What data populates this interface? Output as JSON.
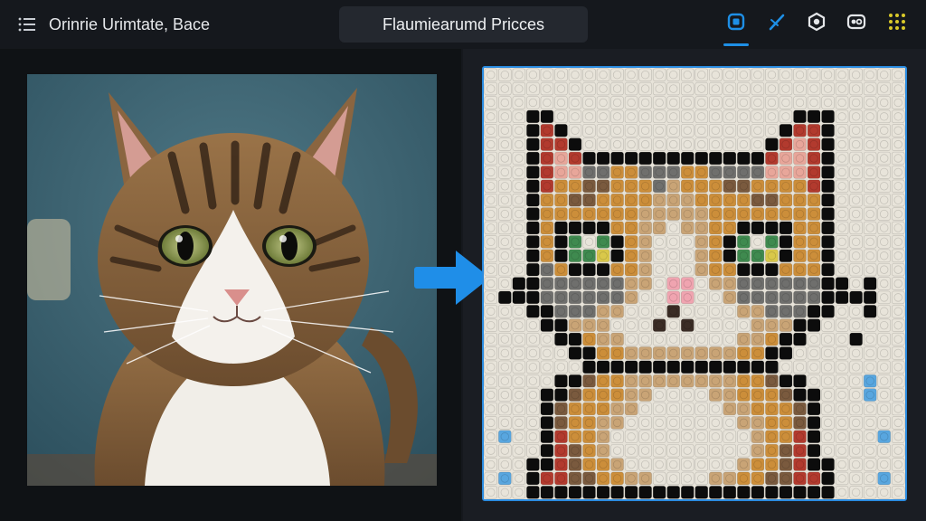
{
  "app": {
    "title": "Orinrie Urimtate, Bace",
    "center_title": "Flaumiearumd Pricces"
  },
  "toolbar": {
    "menu_icon": "list-icon",
    "tools": [
      {
        "name": "image-tool",
        "icon": "image-icon",
        "active": true
      },
      {
        "name": "pencil-tool",
        "icon": "pencil-icon",
        "active": false
      },
      {
        "name": "settings-tool",
        "icon": "cube-gear-icon",
        "active": false
      },
      {
        "name": "swap-tool",
        "icon": "swap-icon",
        "active": false
      },
      {
        "name": "grid-tool",
        "icon": "dots-grid-icon",
        "active": false
      }
    ]
  },
  "colors": {
    "accent": "#1e8fe6",
    "arrow": "#1f8ee8",
    "selection_border": "#2a8be0",
    "grid_dots": "#d9c92a"
  },
  "mosaic": {
    "cols": 30,
    "rows": 31,
    "palette": {
      "W": "#e8e4da",
      "K": "#0c0c0c",
      "R": "#b23a2e",
      "P": "#e8a69a",
      "O": "#cc8e3a",
      "B": "#7a5a3e",
      "G": "#6f6f6d",
      "T": "#c9a476",
      "N": "#3f8a4f",
      "Y": "#d9c84a",
      "L": "#58a6df",
      "S": "#f0a4b0",
      "D": "#3a2c25"
    },
    "rows_data": [
      "WWWWWWWWWWWWWWWWWWWWWWWWWWWWWW",
      "WWWWWWWWWWWWWWWWWWWWWWWWWWWWWW",
      "WWWWWWWWWWWWWWWWWWWWWWWWWWWWWW",
      "WWWKKWWWWWWWWWWWWWWWWWKKKWWWWW",
      "WWWKRKWWWWWWWWWWWWWWWKRRKWWWWW",
      "WWWKRRKWWWWWWWWWWWWWKRPRKWWWWW",
      "WWWKRPRKKKKKKKKKKKKKRPPRKWWWWW",
      "WWWKRPPGGOOGGGOOGGGGPPPRKWWWWW",
      "WWWKROOBBOOOGTOOOBBOOOORKWWWWW",
      "WWWKOOBBOOOOTTTOOOOBBOOOKWWWWW",
      "WWWKOOOOOOOTTTTTOOOOOOOOKWWWWW",
      "WWWKOKKKKOOTTWTTOOKKKKOOKWWWWW",
      "WWWKOKNWNKOTWWWTOKNWNKOOKWWWWW",
      "WWWKOKNNYKOTWWWTOKNNYKOOKWWWWW",
      "WWWKGOKKKOOTWWWTOOKKKOOOKWWWWW",
      "WWKKGGGGGGTTWSSWTTGGGGGGKKWKWW",
      "WKKKGGGGGGTWWSSWWTGGGGGGKKKKWW",
      "WWWKKGGGTTWWWDWWWWTTGGGKKWWKWW",
      "WWWWKKTTTWWWDWDWWWWTTTKKWWWWWW",
      "WWWWWKKOTTWWWWWWWWTTOKKWWWKWWW",
      "WWWWWWKKOOTTTTTTTTOOKKWWWWWWWW",
      "WWWWWWWKKKKKKKKKKKKKKWWWWWWWWW",
      "WWWWWKKBOOTTTTTTTTOOBKKWWWWLWW",
      "WWWWKKBOOOTTWWWWTTOOOBKKWWWLWW",
      "WWWWKBOOOTTWWWWWWTTOOOBKWWWWWW",
      "WWWWKBOOTTWWWWWWWWTTOOBKWWWWWW",
      "WLWWKROOTWWWWWWWWWWTOORKWWWWLW",
      "WWWWKRBOTWWWWWWWWWWTOBRKWWWWWW",
      "WWWKKRBOOTWWWWWWWWTOOBRKKWWWWW",
      "WLWKRRBBOOTTWWWWTTOOBBRRKWWWLW",
      "WWWKKKKKKKKKKKKKKKKKKKKKKWWWWW"
    ]
  }
}
